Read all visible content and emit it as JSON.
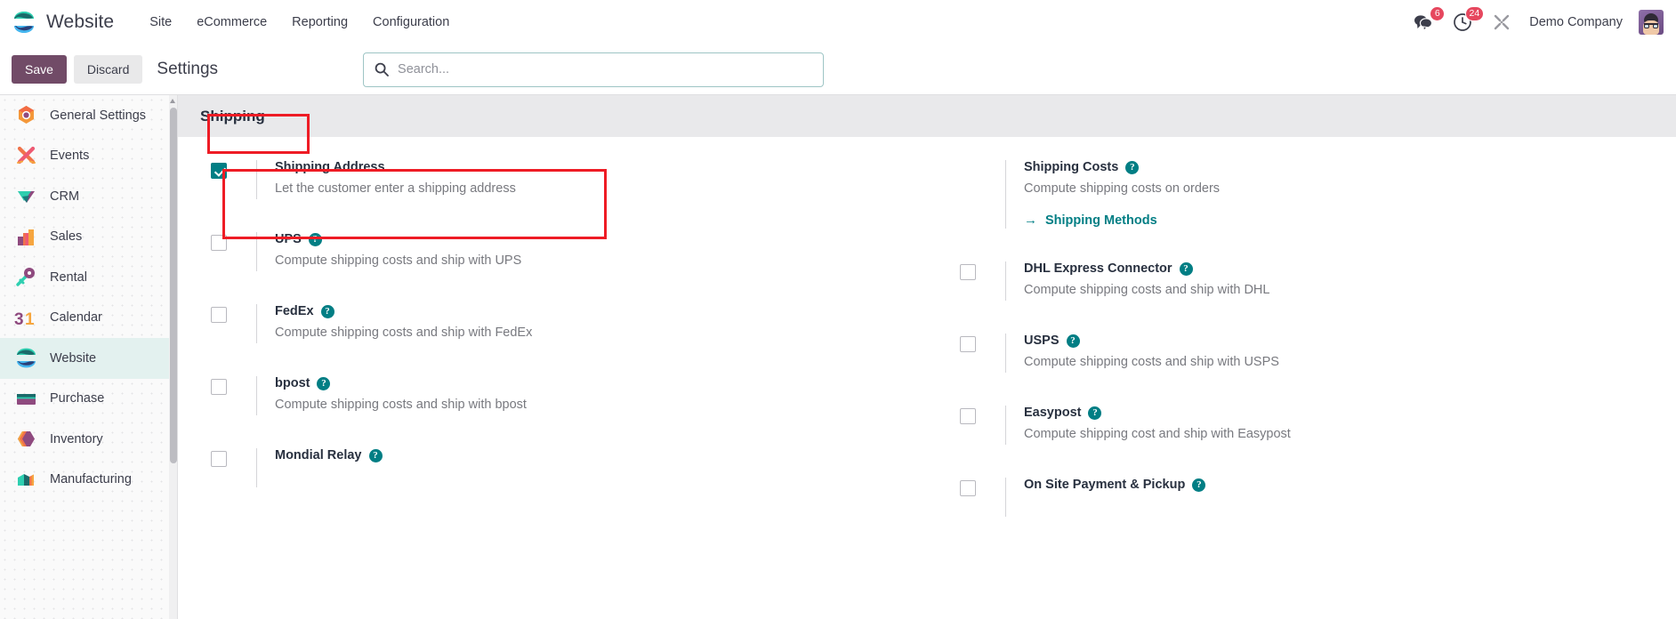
{
  "navbar": {
    "brand": "Website",
    "menu": [
      {
        "label": "Site"
      },
      {
        "label": "eCommerce"
      },
      {
        "label": "Reporting"
      },
      {
        "label": "Configuration"
      }
    ],
    "messages_badge": "6",
    "activities_badge": "24",
    "company": "Demo Company"
  },
  "control_panel": {
    "save_label": "Save",
    "discard_label": "Discard",
    "title": "Settings",
    "search_placeholder": "Search..."
  },
  "sidebar": {
    "items": [
      {
        "label": "General Settings",
        "icon": "settings-app-icon",
        "active": false
      },
      {
        "label": "Events",
        "icon": "events-app-icon",
        "active": false
      },
      {
        "label": "CRM",
        "icon": "crm-app-icon",
        "active": false
      },
      {
        "label": "Sales",
        "icon": "sales-app-icon",
        "active": false
      },
      {
        "label": "Rental",
        "icon": "rental-app-icon",
        "active": false
      },
      {
        "label": "Calendar",
        "icon": "calendar-app-icon",
        "active": false
      },
      {
        "label": "Website",
        "icon": "website-app-icon",
        "active": true
      },
      {
        "label": "Purchase",
        "icon": "purchase-app-icon",
        "active": false
      },
      {
        "label": "Inventory",
        "icon": "inventory-app-icon",
        "active": false
      },
      {
        "label": "Manufacturing",
        "icon": "manufacturing-app-icon",
        "active": false
      }
    ]
  },
  "section": {
    "title": "Shipping"
  },
  "settings": {
    "left": [
      {
        "label": "Shipping Address",
        "desc": "Let the customer enter a shipping address",
        "checked": true,
        "help": false
      },
      {
        "label": "UPS",
        "desc": "Compute shipping costs and ship with UPS",
        "checked": false,
        "help": true
      },
      {
        "label": "FedEx",
        "desc": "Compute shipping costs and ship with FedEx",
        "checked": false,
        "help": true
      },
      {
        "label": "bpost",
        "desc": "Compute shipping costs and ship with bpost",
        "checked": false,
        "help": true
      },
      {
        "label": "Mondial Relay",
        "desc": "",
        "checked": false,
        "help": true
      }
    ],
    "right": [
      {
        "label": "Shipping Costs",
        "desc": "Compute shipping costs on orders",
        "checked": null,
        "help": true,
        "link": "Shipping Methods"
      },
      {
        "label": "DHL Express Connector",
        "desc": "Compute shipping costs and ship with DHL",
        "checked": false,
        "help": true
      },
      {
        "label": "USPS",
        "desc": "Compute shipping costs and ship with USPS",
        "checked": false,
        "help": true
      },
      {
        "label": "Easypost",
        "desc": "Compute shipping cost and ship with Easypost",
        "checked": false,
        "help": true
      },
      {
        "label": "On Site Payment & Pickup",
        "desc": "",
        "checked": false,
        "help": true
      }
    ]
  },
  "colors": {
    "accent_purple": "#714B67",
    "accent_teal": "#017e84",
    "badge_red": "#e6475e",
    "annotation_red": "#ee1c25"
  }
}
